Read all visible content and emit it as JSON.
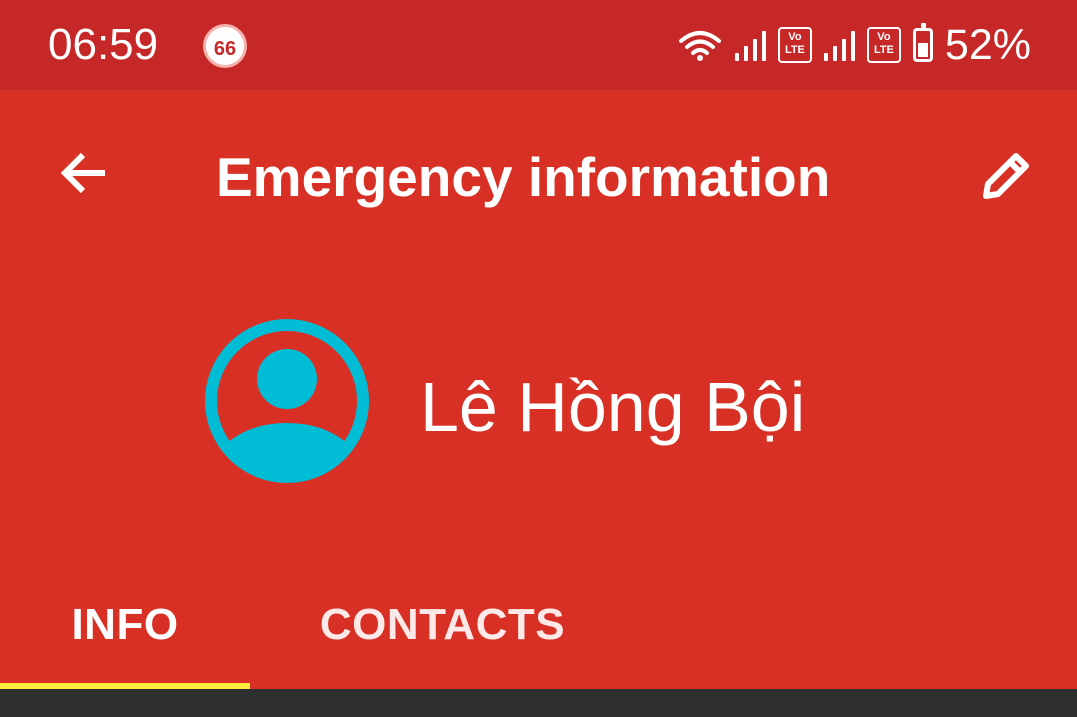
{
  "status_bar": {
    "time": "06:59",
    "notification_badge": "66",
    "volte_1": "Vo LTE",
    "volte_2": "Vo LTE",
    "battery_percent": "52%",
    "battery_level": 0.52,
    "icons": [
      "wifi-icon",
      "signal-1-icon",
      "volte-1-icon",
      "signal-2-icon",
      "volte-2-icon",
      "battery-icon"
    ]
  },
  "app_bar": {
    "title": "Emergency information",
    "back_icon": "arrow-back-icon",
    "edit_icon": "pencil-icon"
  },
  "profile": {
    "name": "Lê Hồng Bội",
    "avatar_icon": "account-circle-icon",
    "avatar_color": "#00bcd4"
  },
  "tabs": [
    {
      "label": "INFO",
      "selected": true
    },
    {
      "label": "CONTACTS",
      "selected": false
    }
  ],
  "colors": {
    "status_bar": "#c62828",
    "app_background": "#d93025",
    "tab_indicator": "#ffeb3b",
    "content_background": "#2f2f2f"
  }
}
